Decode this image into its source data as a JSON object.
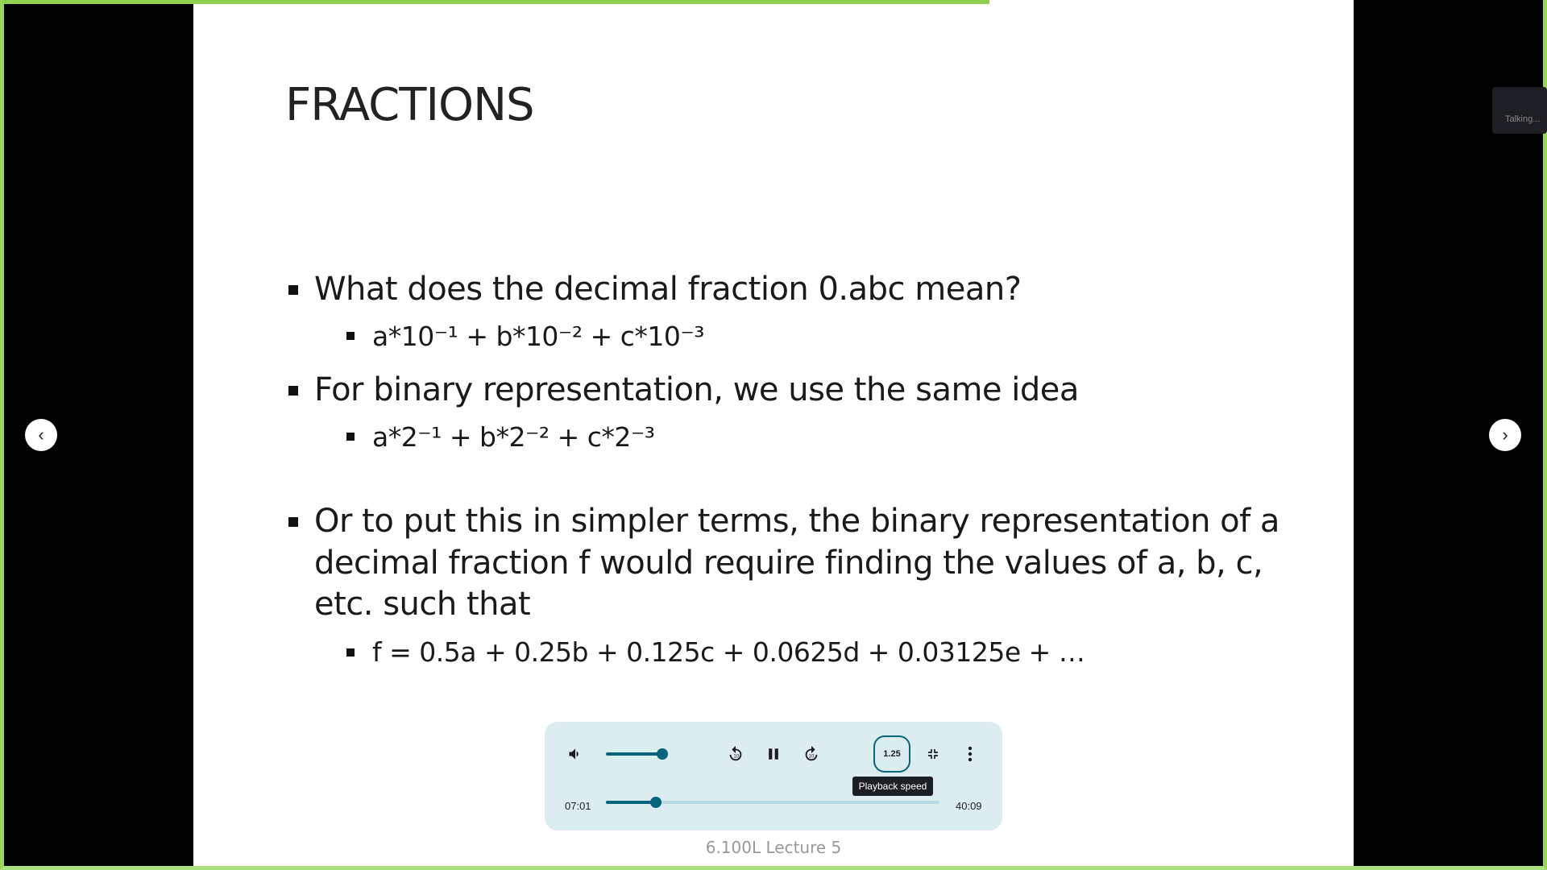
{
  "slide": {
    "title": "FRACTIONS",
    "bullets": [
      {
        "text": "What does the decimal fraction 0.abc mean?",
        "sub": "a*10⁻¹ + b*10⁻² + c*10⁻³"
      },
      {
        "text": "For binary representation, we use the same idea",
        "sub": "a*2⁻¹ + b*2⁻² + c*2⁻³"
      },
      {
        "lines": [
          "Or to put this in simpler terms, the binary representation of a",
          "decimal fraction f would require finding the values of a, b, c,",
          "etc. such that"
        ],
        "sub": "f = 0.5a + 0.25b + 0.125c + 0.0625d + 0.03125e + …"
      }
    ],
    "footer": "6.100L Lecture 5"
  },
  "player": {
    "current_time": "07:01",
    "duration": "40:09",
    "progress": 0.175,
    "volume": 1.0,
    "speed": "1.25",
    "tooltip": "Playback speed",
    "accent": "#05657a"
  },
  "nav": {
    "prev": "‹",
    "next": "›"
  },
  "video_progress": 0.64,
  "talking_widget": "Talking..."
}
